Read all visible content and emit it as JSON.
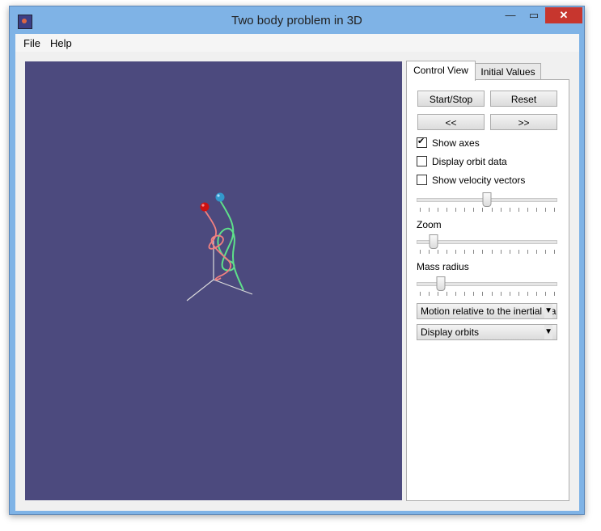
{
  "window": {
    "title": "Two body problem in 3D",
    "minimize": "—",
    "maximize": "▭",
    "close": "✕"
  },
  "menu": {
    "file": "File",
    "help": "Help"
  },
  "tabs": {
    "control_view": "Control View",
    "initial_values": "Initial Values"
  },
  "buttons": {
    "start_stop": "Start/Stop",
    "reset": "Reset",
    "back": "<<",
    "forward": ">>"
  },
  "checkboxes": {
    "show_axes": {
      "label": "Show axes",
      "checked": true
    },
    "orbit_data": {
      "label": "Display orbit data",
      "checked": false
    },
    "velocity": {
      "label": "Show velocity vectors",
      "checked": false
    }
  },
  "sliders": {
    "speed": {
      "value": 0.5
    },
    "zoom": {
      "label": "Zoom",
      "value": 0.1
    },
    "mass_radius": {
      "label": "Mass radius",
      "value": 0.15
    }
  },
  "dropdowns": {
    "frame": "Motion relative to the inertial fra",
    "orbits": "Display orbits"
  },
  "colors": {
    "viewport_bg": "#4c4a7e",
    "orbit_red": "#f08080",
    "orbit_green": "#5ee08a",
    "body_red": "#cc1111",
    "body_blue": "#3399cc",
    "axes": "#dddddd"
  }
}
